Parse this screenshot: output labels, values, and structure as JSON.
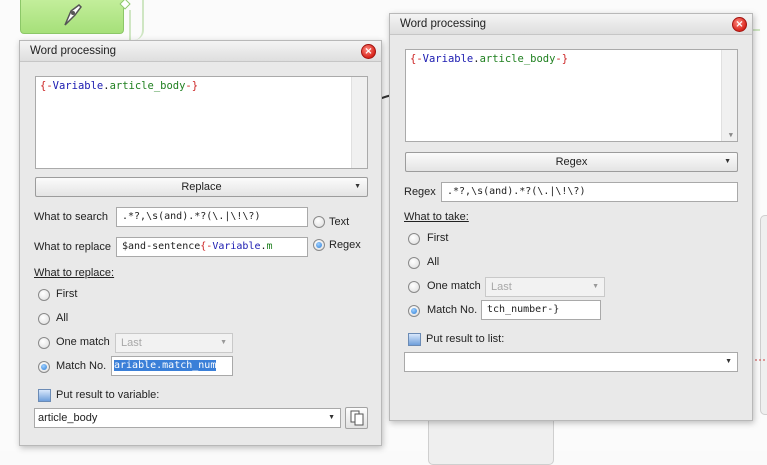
{
  "colors": {
    "accent_green": "#a6e07a",
    "close_red": "#d9251c",
    "selection_blue": "#3a7fd8",
    "code_brace": "#cc2222",
    "code_var": "#1a1ab0",
    "code_prop": "#208020"
  },
  "icons": [
    "pen-nib-icon",
    "close-icon",
    "chevron-down-icon",
    "checkbox-icon",
    "copy-icon"
  ],
  "left": {
    "title": "Word processing",
    "code": {
      "open": "{-",
      "var": "Variable",
      "dot": ".",
      "prop": "article_body",
      "close": "-}"
    },
    "action": "Replace",
    "search_label": "What to search",
    "search_value": ".*?,\\s(and).*?(\\.|\\!\\?)",
    "replace_label": "What to replace",
    "replace_prefix": "$and-sentence",
    "replace_open": "{-",
    "replace_var": "Variable",
    "replace_dot": ".",
    "replace_tail": "m",
    "mode_text": "Text",
    "mode_regex": "Regex",
    "section": "What to replace:",
    "first": "First",
    "all": "All",
    "one_match": "One match",
    "one_match_value": "Last",
    "match_no": "Match No.",
    "match_no_value": "ariable.match_num",
    "result_label": "Put result to variable:",
    "result_value": "article_body"
  },
  "right": {
    "title": "Word processing",
    "code": {
      "open": "{-",
      "var": "Variable",
      "dot": ".",
      "prop": "article_body",
      "close": "-}"
    },
    "action": "Regex",
    "regex_label": "Regex",
    "regex_value": ".*?,\\s(and).*?(\\.|\\!\\?)",
    "section": "What to take:",
    "first": "First",
    "all": "All",
    "one_match": "One match",
    "one_match_value": "Last",
    "match_no": "Match No.",
    "match_no_value": "tch_number-}",
    "result_label": "Put result to list:",
    "result_value": ""
  }
}
